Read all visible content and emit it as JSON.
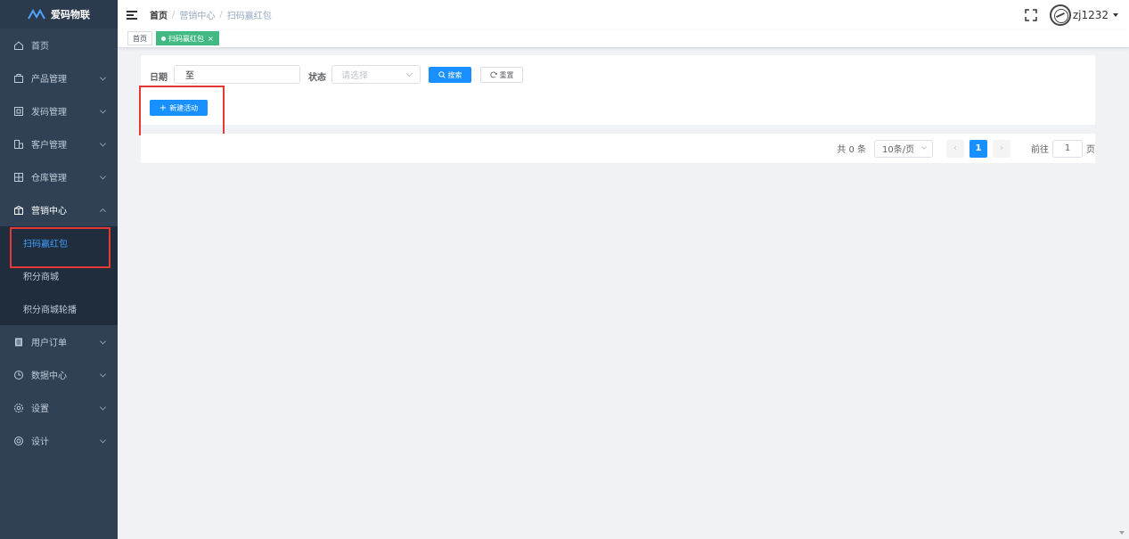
{
  "app": {
    "logo_text": "爱码物联"
  },
  "sidebar": {
    "items": [
      {
        "label": "首页",
        "icon": "home-icon"
      },
      {
        "label": "产品管理",
        "icon": "product-icon"
      },
      {
        "label": "发码管理",
        "icon": "code-icon"
      },
      {
        "label": "客户管理",
        "icon": "customer-icon"
      },
      {
        "label": "仓库管理",
        "icon": "warehouse-icon"
      },
      {
        "label": "营销中心",
        "icon": "marketing-icon"
      },
      {
        "label": "用户订单",
        "icon": "order-icon"
      },
      {
        "label": "数据中心",
        "icon": "data-icon"
      },
      {
        "label": "设置",
        "icon": "settings-icon"
      },
      {
        "label": "设计",
        "icon": "design-icon"
      }
    ],
    "marketing_sub": [
      {
        "label": "扫码赢红包"
      },
      {
        "label": "积分商城"
      },
      {
        "label": "积分商城轮播"
      }
    ]
  },
  "header": {
    "breadcrumb": [
      "首页",
      "营销中心",
      "扫码赢红包"
    ],
    "breadcrumb_sep": "/",
    "username": "zj1232"
  },
  "tags": [
    {
      "label": "首页"
    },
    {
      "label": "扫码赢红包",
      "close": "×"
    }
  ],
  "search": {
    "date_label": "日期",
    "date_value": "至",
    "status_label": "状态",
    "status_placeholder": "请选择",
    "search_label": "搜索",
    "reset_label": "重置",
    "new_label": "新建活动"
  },
  "pagination": {
    "total": "共 0 条",
    "page_size": "10条/页",
    "current_page": "1",
    "goto_prefix": "前往",
    "goto_value": "1",
    "goto_suffix": "页"
  },
  "colors": {
    "primary": "#1890ff",
    "sidebar": "#304156",
    "tag_active": "#42b983",
    "highlight": "#e53935"
  }
}
